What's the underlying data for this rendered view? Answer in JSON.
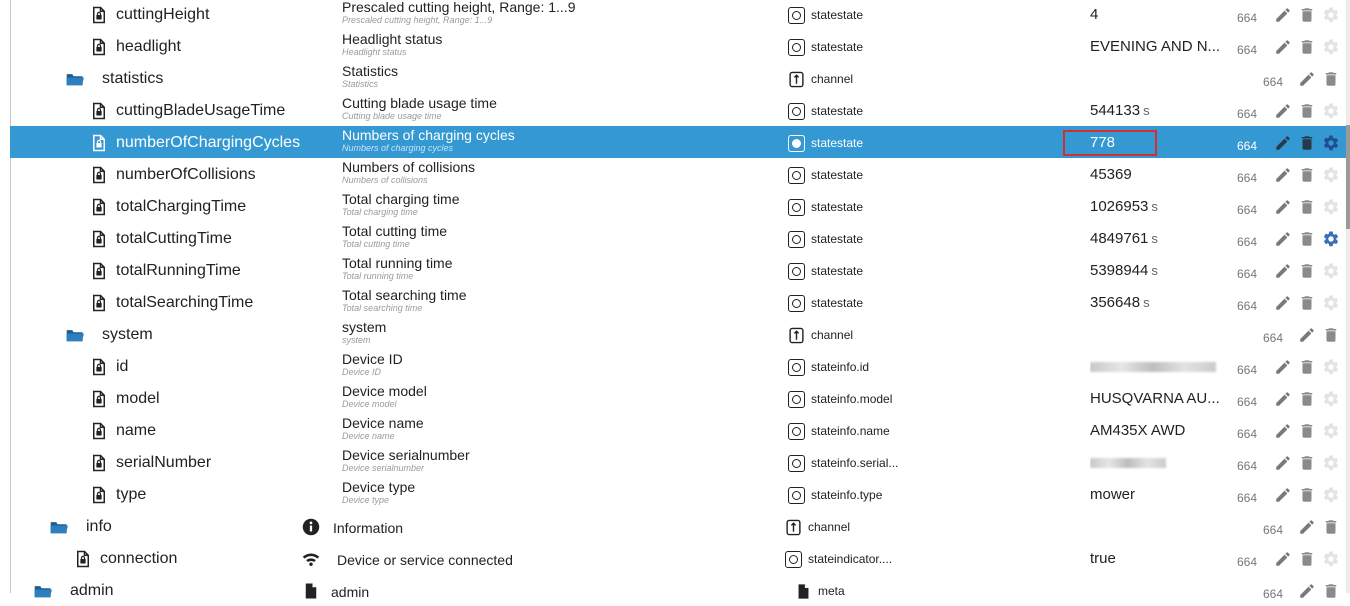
{
  "rows": [
    {
      "name": "cuttingHeight",
      "kind": "state",
      "desc": "Prescaled cutting height, Range: 1...9",
      "desc_sub": "Prescaled cutting height, Range: 1...9",
      "role_icon": "state-icon",
      "role": "statestate",
      "value": "4",
      "acl": "664",
      "settings_icon": "gear-icon"
    },
    {
      "name": "headlight",
      "kind": "state",
      "desc": "Headlight status",
      "desc_sub": "Headlight status",
      "role_icon": "state-icon",
      "role": "statestate",
      "value": "EVENING AND N...",
      "acl": "664",
      "settings_icon": "gear-icon"
    },
    {
      "name": "statistics",
      "kind": "folder",
      "desc": "Statistics",
      "desc_sub": "Statistics",
      "role_icon": "channel-icon",
      "role": "channel",
      "value": "",
      "acl": "664"
    },
    {
      "name": "cuttingBladeUsageTime",
      "kind": "state",
      "desc": "Cutting blade usage time",
      "desc_sub": "Cutting blade usage time",
      "role_icon": "state-icon",
      "role": "statestate",
      "value": "544133",
      "unit": "s",
      "acl": "664",
      "settings_icon": "gear-icon"
    },
    {
      "name": "numberOfChargingCycles",
      "kind": "state",
      "desc": "Numbers of charging cycles",
      "desc_sub": "Numbers of charging cycles",
      "role_icon": "state-icon",
      "role": "statestate",
      "value": "778",
      "acl": "664",
      "settings_icon": "gear-icon",
      "selected": true,
      "highlighted": true,
      "gear_active": true
    },
    {
      "name": "numberOfCollisions",
      "kind": "state",
      "desc": "Numbers of collisions",
      "desc_sub": "Numbers of collisions",
      "role_icon": "state-icon",
      "role": "statestate",
      "value": "45369",
      "acl": "664",
      "settings_icon": "gear-icon"
    },
    {
      "name": "totalChargingTime",
      "kind": "state",
      "desc": "Total charging time",
      "desc_sub": "Total charging time",
      "role_icon": "state-icon",
      "role": "statestate",
      "value": "1026953",
      "unit": "s",
      "acl": "664",
      "settings_icon": "gear-icon"
    },
    {
      "name": "totalCuttingTime",
      "kind": "state",
      "desc": "Total cutting time",
      "desc_sub": "Total cutting time",
      "role_icon": "state-icon",
      "role": "statestate",
      "value": "4849761",
      "unit": "s",
      "acl": "664",
      "settings_icon": "gear-icon",
      "gear_active": true
    },
    {
      "name": "totalRunningTime",
      "kind": "state",
      "desc": "Total running time",
      "desc_sub": "Total running time",
      "role_icon": "state-icon",
      "role": "statestate",
      "value": "5398944",
      "unit": "s",
      "acl": "664",
      "settings_icon": "gear-icon"
    },
    {
      "name": "totalSearchingTime",
      "kind": "state",
      "desc": "Total searching time",
      "desc_sub": "Total searching time",
      "role_icon": "state-icon",
      "role": "statestate",
      "value": "356648",
      "unit": "s",
      "acl": "664",
      "settings_icon": "gear-icon"
    },
    {
      "name": "system",
      "kind": "folder",
      "desc": "system",
      "desc_sub": "system",
      "role_icon": "channel-icon",
      "role": "channel",
      "value": "",
      "acl": "664"
    },
    {
      "name": "id",
      "kind": "state",
      "desc": "Device ID",
      "desc_sub": "Device ID",
      "role_icon": "state-icon",
      "role": "stateinfo.id",
      "value": "",
      "blurred": "long",
      "acl": "664",
      "settings_icon": "gear-icon"
    },
    {
      "name": "model",
      "kind": "state",
      "desc": "Device model",
      "desc_sub": "Device model",
      "role_icon": "state-icon",
      "role": "stateinfo.model",
      "value": "HUSQVARNA AU...",
      "acl": "664",
      "settings_icon": "gear-icon"
    },
    {
      "name": "name",
      "kind": "state",
      "desc": "Device name",
      "desc_sub": "Device name",
      "role_icon": "state-icon",
      "role": "stateinfo.name",
      "value": "AM435X AWD",
      "acl": "664",
      "settings_icon": "gear-icon"
    },
    {
      "name": "serialNumber",
      "kind": "state",
      "desc": "Device serialnumber",
      "desc_sub": "Device serialnumber",
      "role_icon": "state-icon",
      "role": "stateinfo.serial...",
      "value": "",
      "blurred": "short",
      "acl": "664",
      "settings_icon": "gear-icon"
    },
    {
      "name": "type",
      "kind": "state",
      "desc": "Device type",
      "desc_sub": "Device type",
      "role_icon": "state-icon",
      "role": "stateinfo.type",
      "value": "mower",
      "acl": "664",
      "settings_icon": "gear-icon"
    },
    {
      "name": "info",
      "kind": "folder",
      "level": "upper",
      "desc": "Information",
      "desc_icon": "info-icon",
      "role_icon": "channel-icon",
      "role": "channel",
      "value": "",
      "acl": "664"
    },
    {
      "name": "connection",
      "kind": "state",
      "level": "upper",
      "desc": "Device or service connected",
      "desc_icon": "wifi-icon",
      "role_icon": "state-icon",
      "role": "stateindicator....",
      "value": "true",
      "acl": "664",
      "settings_icon": "gear-icon"
    },
    {
      "name": "admin",
      "kind": "folder",
      "level": "top",
      "desc": "admin",
      "desc_icon": "file-icon",
      "role_icon": "meta-icon",
      "role": "meta",
      "value": "",
      "acl": "664"
    }
  ]
}
